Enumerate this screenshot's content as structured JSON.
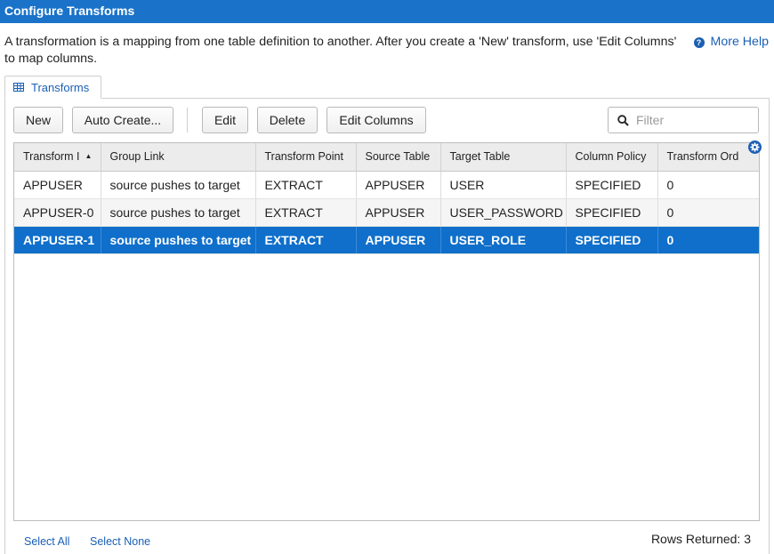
{
  "window": {
    "title": "Configure Transforms"
  },
  "description": "A transformation is a mapping from one table definition to another. After you create a 'New' transform, use 'Edit Columns' to map columns.",
  "help": {
    "label": "More Help",
    "icon": "help-icon"
  },
  "tabs": [
    {
      "label": "Transforms",
      "icon": "table-icon"
    }
  ],
  "toolbar": {
    "new_label": "New",
    "auto_create_label": "Auto Create...",
    "edit_label": "Edit",
    "delete_label": "Delete",
    "edit_columns_label": "Edit Columns",
    "filter_placeholder": "Filter",
    "filter_value": ""
  },
  "grid": {
    "columns": [
      "Transform I",
      "Group Link",
      "Transform Point",
      "Source Table",
      "Target Table",
      "Column Policy",
      "Transform Ord"
    ],
    "sort_column": "Transform I",
    "sort_direction": "ascending",
    "rows": [
      [
        "APPUSER",
        "source pushes to target",
        "EXTRACT",
        "APPUSER",
        "USER",
        "SPECIFIED",
        "0"
      ],
      [
        "APPUSER-0",
        "source pushes to target",
        "EXTRACT",
        "APPUSER",
        "USER_PASSWORD",
        "SPECIFIED",
        "0"
      ],
      [
        "APPUSER-1",
        "source pushes to target",
        "EXTRACT",
        "APPUSER",
        "USER_ROLE",
        "SPECIFIED",
        "0"
      ]
    ],
    "selected_row": 2
  },
  "footer": {
    "select_all": "Select All",
    "select_none": "Select None",
    "rows_returned": "Rows Returned: 3"
  },
  "colors": {
    "accent": "#1a73c9",
    "selection": "#0f6fcb",
    "link": "#1a5fb4"
  }
}
